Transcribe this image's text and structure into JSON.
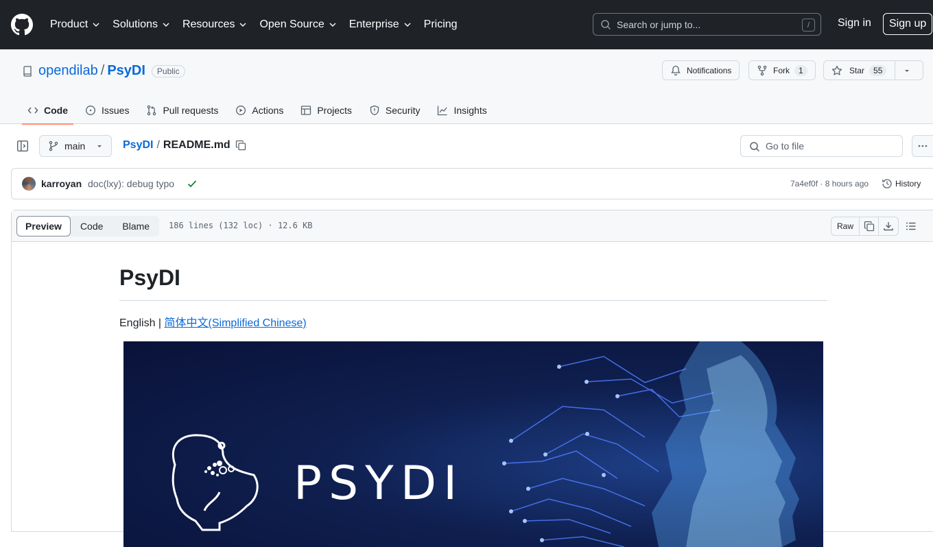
{
  "header": {
    "nav": [
      {
        "label": "Product",
        "has_menu": true
      },
      {
        "label": "Solutions",
        "has_menu": true
      },
      {
        "label": "Resources",
        "has_menu": true
      },
      {
        "label": "Open Source",
        "has_menu": true
      },
      {
        "label": "Enterprise",
        "has_menu": true
      },
      {
        "label": "Pricing",
        "has_menu": false
      }
    ],
    "search_placeholder": "Search or jump to...",
    "search_shortcut": "/",
    "sign_in": "Sign in",
    "sign_up": "Sign up"
  },
  "repo": {
    "owner": "opendilab",
    "separator": "/",
    "name": "PsyDI",
    "visibility": "Public",
    "notifications": "Notifications",
    "fork_label": "Fork",
    "fork_count": "1",
    "star_label": "Star",
    "star_count": "55"
  },
  "tabs": [
    {
      "label": "Code",
      "icon": "code-icon",
      "active": true
    },
    {
      "label": "Issues",
      "icon": "issue-icon"
    },
    {
      "label": "Pull requests",
      "icon": "pull-request-icon"
    },
    {
      "label": "Actions",
      "icon": "play-icon"
    },
    {
      "label": "Projects",
      "icon": "table-icon"
    },
    {
      "label": "Security",
      "icon": "shield-icon"
    },
    {
      "label": "Insights",
      "icon": "graph-icon"
    }
  ],
  "file": {
    "branch": "main",
    "crumb_repo": "PsyDI",
    "crumb_sep": "/",
    "crumb_file": "README.md",
    "goto_placeholder": "Go to file"
  },
  "commit": {
    "author": "karroyan",
    "message": "doc(lxy): debug typo",
    "sha": "7a4ef0f",
    "time": "8 hours ago",
    "sha_time": "7a4ef0f · 8 hours ago",
    "history": "History"
  },
  "viewer": {
    "modes": [
      "Preview",
      "Code",
      "Blame"
    ],
    "meta": "186 lines (132 loc) · 12.6 KB",
    "raw": "Raw"
  },
  "readme": {
    "title": "PsyDI",
    "lang_prefix": "English | ",
    "lang_link": "简体中文(Simplified Chinese)",
    "banner_text": "PSYDI"
  },
  "colors": {
    "header_bg": "#1f2328",
    "link": "#0969da",
    "active_tab_underline": "#fd8c73",
    "banner_bg": "#0f1f4f",
    "check": "#1a7f37"
  }
}
